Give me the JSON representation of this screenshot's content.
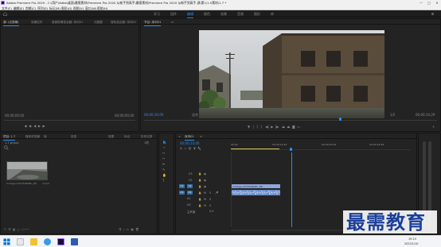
{
  "titlebar": {
    "title": "Adobe Premiere Pro 2020 - C:\\用户\\Adbe\\桌面\\最需素材\\Premiere Pro 2020 从新手到高手\\最需素材\\Premiere Pro 2020 从新手到高手-源\\第1\\1.5素材\\1.7 *",
    "minimize": "—",
    "maximize": "□",
    "close": "✕"
  },
  "menubar": {
    "items": [
      "文件(F)",
      "编辑(E)",
      "剪辑(C)",
      "序列(S)",
      "标记(M)",
      "图形(G)",
      "视图(V)",
      "窗口(W)",
      "帮助(H)"
    ]
  },
  "workspace": {
    "tabs": [
      "学习",
      "组件",
      "编辑",
      "颜色",
      "效果",
      "音频",
      "图形",
      "库"
    ],
    "active_index": 2
  },
  "source_panel": {
    "tabs": [
      "源: (无剪辑)",
      "效果控件",
      "音频剪辑混合器: 序列01",
      "元数据",
      "音轨混合器: 序列01"
    ],
    "active_index": 0,
    "timecode_left": "00;00;00;00",
    "timecode_right": "00;00;00;00"
  },
  "program_panel": {
    "tab": "节目: 序列01",
    "timecode_current": "00;00;10;00",
    "fit": "适合",
    "quality": "1/2",
    "timecode_duration": "00;00;14;29"
  },
  "project_panel": {
    "tabs": [
      "项目: 1.7",
      "媒体浏览器",
      "库",
      "信息",
      "效果",
      "标记",
      "历史记录"
    ],
    "active_index": 0,
    "project_file": "1.7.prproj",
    "clip_name": "Vintage-ATTCHANNEL_EN",
    "clip_duration": "14;29",
    "item_count": "1项"
  },
  "timeline": {
    "tab": "序列01",
    "timecode": "00;00;10;00",
    "ruler": [
      "00;00",
      "00;00;14;29",
      "00;00;29;29",
      "00;00;44;28"
    ],
    "tracks": [
      {
        "label": "V3",
        "target": "V3"
      },
      {
        "label": "V2",
        "target": "V2"
      },
      {
        "label": "V1",
        "target": "V1"
      },
      {
        "label": "A1",
        "target": "A1"
      },
      {
        "label": "A2",
        "target": "A2"
      },
      {
        "label": "A3",
        "target": "A3"
      }
    ],
    "master_label": "主声道",
    "master_value": "0.0",
    "video_clip": "Vintage-ATTCHANNEL_EN",
    "playhead_position": 0.67
  },
  "taskbar": {
    "time": "19:13",
    "date": "2022/1/10"
  },
  "watermark": {
    "text": "最需教育"
  }
}
